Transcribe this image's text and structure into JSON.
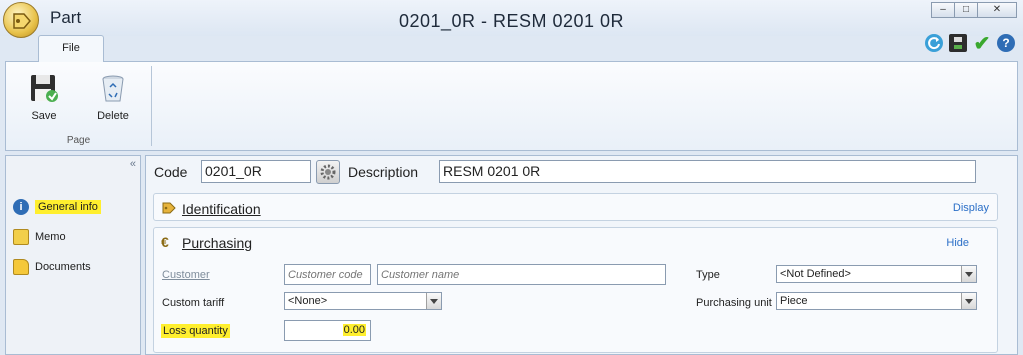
{
  "titlebar": {
    "app_name": "Part",
    "window_title": "0201_0R - RESM 0201 0R"
  },
  "window_buttons": {
    "minimize": "–",
    "maximize": "□",
    "close": "✕"
  },
  "quick_icons": [
    "refresh-icon",
    "save-icon",
    "confirm-check-icon",
    "help-icon"
  ],
  "ribbon": {
    "tab": "File",
    "group_label": "Page",
    "buttons": [
      {
        "label": "Save"
      },
      {
        "label": "Delete"
      }
    ]
  },
  "nav": {
    "items": [
      {
        "label": "General info",
        "active": true
      },
      {
        "label": "Memo"
      },
      {
        "label": "Documents"
      }
    ]
  },
  "header": {
    "code_label": "Code",
    "code_value": "0201_0R",
    "description_label": "Description",
    "description_value": "RESM 0201 0R"
  },
  "identification": {
    "title": "Identification",
    "action": "Display"
  },
  "purchasing": {
    "title": "Purchasing",
    "action": "Hide",
    "customer_label": "Customer",
    "customer_code_placeholder": "Customer code",
    "customer_name_placeholder": "Customer name",
    "type_label": "Type",
    "type_value": "<Not Defined>",
    "custom_tariff_label": "Custom tariff",
    "custom_tariff_value": "<None>",
    "purchasing_unit_label": "Purchasing unit",
    "purchasing_unit_value": "Piece",
    "loss_quantity_label": "Loss quantity",
    "loss_quantity_value": "0.00"
  },
  "colors": {
    "highlight": "#ffef2e",
    "link": "#2b6fc7",
    "border": "#a9bcd3"
  }
}
